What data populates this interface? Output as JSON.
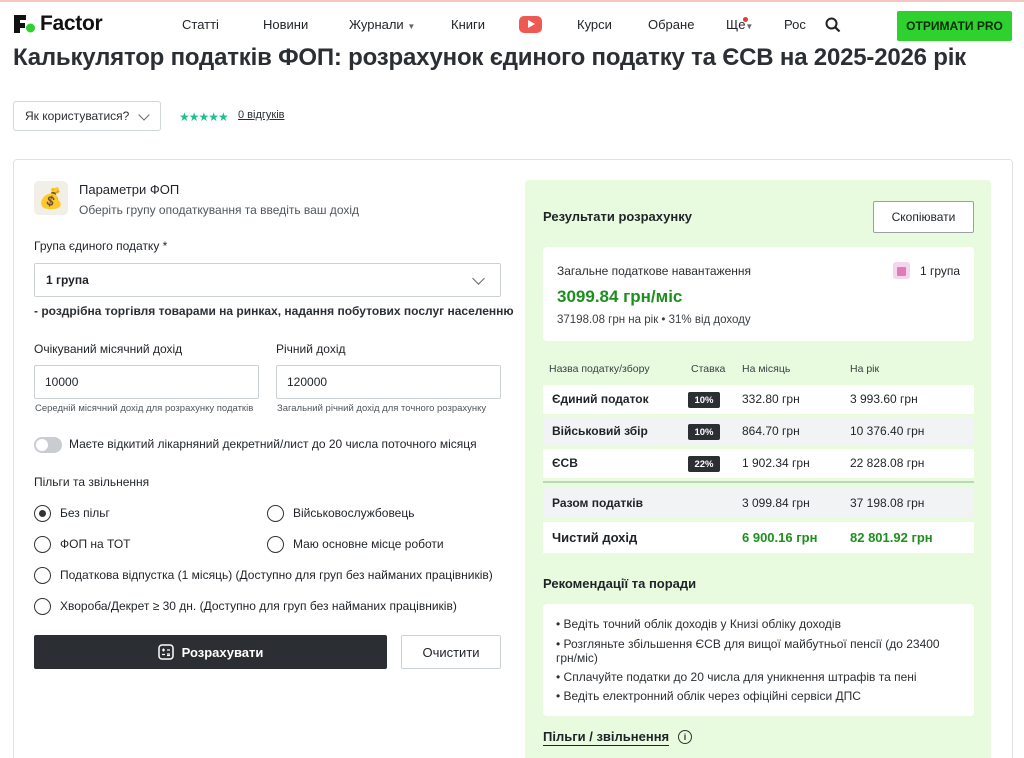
{
  "nav": {
    "logo_text": "Factor",
    "items": [
      "Статті",
      "Новини",
      "Журнали",
      "Книги",
      "Курси",
      "Обране",
      "Ще",
      "Рос"
    ],
    "pro_button": "ОТРИМАТИ PRO",
    "accent_color": "#2ed12e"
  },
  "page": {
    "title": "Калькулятор податків ФОП: розрахунок єдиного податку та ЄСВ на 2025-2026 рік",
    "how_to_use": "Як користуватися?",
    "rating_stars": "★★★★★",
    "reviews": "0 відгуків"
  },
  "form": {
    "title": "Параметри ФОП",
    "subtitle": "Оберіть групу оподаткування та введіть ваш дохід",
    "group_label": "Група єдиного податку *",
    "group_value": "1 група",
    "group_desc": "- роздрібна торгівля товарами на ринках, надання побутових послуг населенню",
    "monthly_label": "Очікуваний місячний дохід",
    "monthly_value": "10000",
    "monthly_hint": "Середній місячний дохід для розрахунку податків",
    "yearly_label": "Річний дохід",
    "yearly_value": "120000",
    "yearly_hint": "Загальний річний дохід для точного розрахунку",
    "sick_toggle": "Маєте відкитий лікарняний декретний/лист до 20 числа поточного місяця",
    "benefits_label": "Пільги та звільнення",
    "options": {
      "none": "Без пільг",
      "military": "Військовослужбовець",
      "tot": "ФОП на ТОТ",
      "main_job": "Маю основне місце роботи",
      "vacation": "Податкова відпустка (1 місяць) (Доступно для груп без найманих працівників)",
      "sick": "Хвороба/Декрет ≥ 30 дн. (Доступно для груп без найманих працівників)"
    },
    "calc_button": "Розрахувати",
    "clear_button": "Очистити"
  },
  "results": {
    "title": "Результати розрахунку",
    "copy_button": "Скопіювати",
    "load_label": "Загальне податкове навантаження",
    "load_value": "3099.84 грн/міс",
    "load_sub": "37198.08 грн на рік • 31% від доходу",
    "group_badge": "1 група",
    "table_headers": [
      "Назва податку/збору",
      "Ставка",
      "На місяць",
      "На рік"
    ],
    "rows": [
      {
        "name": "Єдиний податок",
        "rate": "10%",
        "month": "332.80 грн",
        "year": "3 993.60 грн"
      },
      {
        "name": "Військовий збір",
        "rate": "10%",
        "month": "864.70 грн",
        "year": "10 376.40 грн"
      },
      {
        "name": "ЄСВ",
        "rate": "22%",
        "month": "1 902.34 грн",
        "year": "22 828.08 грн"
      }
    ],
    "total": {
      "name": "Разом податків",
      "month": "3 099.84 грн",
      "year": "37 198.08 грн"
    },
    "net": {
      "name": "Чистий дохід",
      "month": "6 900.16 грн",
      "year": "82 801.92 грн"
    },
    "rec_title": "Рекомендації та поради",
    "recommendations": [
      "• Ведіть точний облік доходів у Книзі обліку доходів",
      "• Розгляньте збільшення ЄСВ для вищої майбутньої пенсії (до 23400 грн/міс)",
      "• Сплачуйте податки до 20 числа для уникнення штрафів та пені",
      "• Ведіть електронний облік через офіційні сервіси ДПС"
    ],
    "benefits_link": "Пільги / звільнення"
  }
}
